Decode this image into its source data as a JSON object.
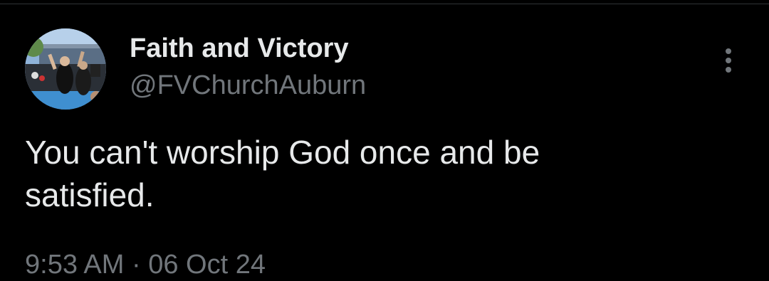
{
  "post": {
    "author": {
      "display_name": "Faith and Victory",
      "handle": "@FVChurchAuburn",
      "avatar_icon": "profile-photo"
    },
    "text": "You can't worship God once and be satisfied.",
    "time": "9:53 AM",
    "separator": "·",
    "date": "06 Oct 24",
    "more_icon": "more-vertical-icon"
  },
  "colors": {
    "background": "#000000",
    "primary_text": "#e7e9ea",
    "secondary_text": "#71767b",
    "divider": "#2f3336"
  }
}
